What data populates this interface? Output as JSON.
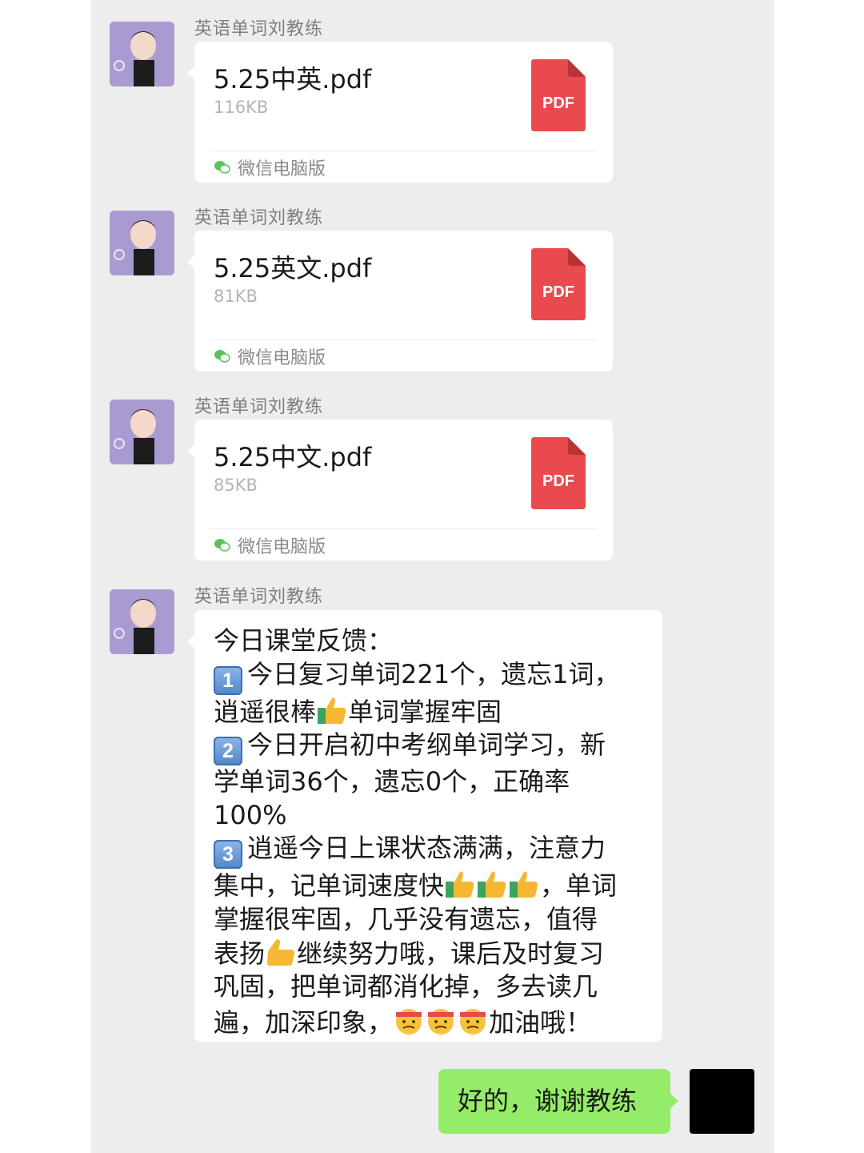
{
  "contact": {
    "name": "英语单词刘教练"
  },
  "files": [
    {
      "name": "5.25中英.pdf",
      "size": "116KB",
      "icon_label": "PDF",
      "source": "微信电脑版"
    },
    {
      "name": "5.25英文.pdf",
      "size": "81KB",
      "icon_label": "PDF",
      "source": "微信电脑版"
    },
    {
      "name": "5.25中文.pdf",
      "size": "85KB",
      "icon_label": "PDF",
      "source": "微信电脑版"
    }
  ],
  "feedback": {
    "lines": [
      "今日课堂反馈：",
      "今日复习单词221个，遗忘1词，",
      "逍遥很棒",
      "单词掌握牢固",
      "今日开启初中考纲单词学习，新",
      "学单词36个，遗忘0个，正确率",
      "100%",
      "逍遥今日上课状态满满，注意力",
      "集中，记单词速度快",
      "，单词",
      "掌握很牢固，几乎没有遗忘，值得",
      "表扬",
      "继续努力哦，课后及时复习",
      "巩固，把单词都消化掉，多去读几",
      "遍，加深印象，",
      "加油哦！"
    ],
    "keycaps": [
      "1",
      "2",
      "3"
    ],
    "emoji": {
      "thumbs": "thumbs-up-icon",
      "fighting": "headband-face-icon"
    }
  },
  "reply": {
    "text": "好的，谢谢教练"
  },
  "colors": {
    "chat_bg": "#ededed",
    "my_bubble": "#95ec69",
    "pdf_red": "#e84a4d",
    "avatar_bg": "#a99bd1"
  }
}
